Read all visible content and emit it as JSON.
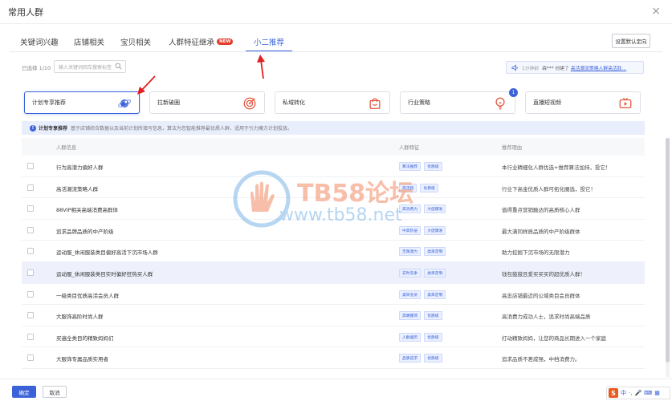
{
  "dialog": {
    "title": "常用人群",
    "close": "×"
  },
  "tabs": [
    {
      "label": "关键词兴趣"
    },
    {
      "label": "店铺相关"
    },
    {
      "label": "宝贝相关"
    },
    {
      "label": "人群特征继承",
      "badge": "NEW"
    },
    {
      "label": "小二推荐",
      "active": true
    }
  ],
  "toolbar": {
    "default_targeting": "设置默认定向"
  },
  "filter": {
    "selected_count": "已选择 1/10",
    "search_placeholder": "输入关键词回车搜索标签"
  },
  "notice": {
    "time": "1分钟前",
    "text": "森***  创建了",
    "link": "高活潮流策略人群高活跃..."
  },
  "cards": [
    {
      "label": "计划专享推荐",
      "icon": "planet-icon",
      "active": true
    },
    {
      "label": "拉新破圈",
      "icon": "target-icon"
    },
    {
      "label": "私域转化",
      "icon": "shopping-bag-icon"
    },
    {
      "label": "行业策略",
      "icon": "lightbulb-icon",
      "badge": "1"
    },
    {
      "label": "直播短视频",
      "icon": "video-icon"
    }
  ],
  "info": {
    "title": "计划专享推荐",
    "text": "基于店铺综合数据以及当前计划所填写信息，算法为您智能推荐最优质人群，适用于引力魔方计划投放。"
  },
  "table": {
    "columns": [
      "人群信息",
      "人群特征",
      "推荐理由"
    ],
    "rows": [
      {
        "name": "行为高潜力偏好人群",
        "tags": [
          "算法推荐",
          "优质级"
        ],
        "reason": "本行业精细化人群优选+推荐算法加持，投它！"
      },
      {
        "name": "高活潮流策略人群",
        "tags": [
          "高活跃",
          "优质级"
        ],
        "reason": "行业下高金优质人群可拓化圈选，投它！"
      },
      {
        "name": "88VIP相关高端消费高群体",
        "tags": [
          "高消费力",
          "大促爆发"
        ],
        "reason": "值得重点营销触达的高质核心人群"
      },
      {
        "name": "追求品牌品质的中产阶级",
        "tags": [
          "中高阶层",
          "大促爆发"
        ],
        "reason": "最大满同样质品质的中产阶级群体"
      },
      {
        "name": "运动服_休闲服装类目偏好高活下沉市场人群",
        "tags": [
          "无限潜力",
          "类目定制"
        ],
        "reason": "助力挖掘下沉市场的无限潜力"
      },
      {
        "name": "运动服_休闲服装类目实时偏好狂热买人群",
        "tags": [
          "实时竞争",
          "类目定制"
        ],
        "reason": "钱包鼓鼓且爱买买买的超优质人群！",
        "highlight": true
      },
      {
        "name": "一级类目优质高活会员人群",
        "tags": [
          "类目会员",
          "类目定制"
        ],
        "reason": "高忠店铺最近的公域类目会员群体"
      },
      {
        "name": "大服饰高阶时尚人群",
        "tags": [
          "高端服饰",
          "优质级"
        ],
        "reason": "高消费力成功人士，追求时尚高端品质"
      },
      {
        "name": "买遍全类目的精致妈妈们",
        "tags": [
          "人群遍历",
          "优质级"
        ],
        "reason": "打动精致妈妈，让您的商品长期进入一个家庭"
      },
      {
        "name": "大服饰专属品质实用者",
        "tags": [
          "品质追求",
          "优质级"
        ],
        "reason": "追求品质不差成强，中档消费力。"
      }
    ]
  },
  "footer": {
    "confirm": "确定",
    "cancel": "取消"
  },
  "ime": {
    "logo": "S",
    "items": [
      "中",
      "·,",
      "🎤",
      "⌨",
      "▦"
    ]
  },
  "watermark": {
    "line1": "TB58论坛",
    "line2": "www.tb58.net"
  },
  "colors": {
    "accent": "#3b62d8",
    "badge": "#e23c2b",
    "annotation": "#e02020"
  }
}
